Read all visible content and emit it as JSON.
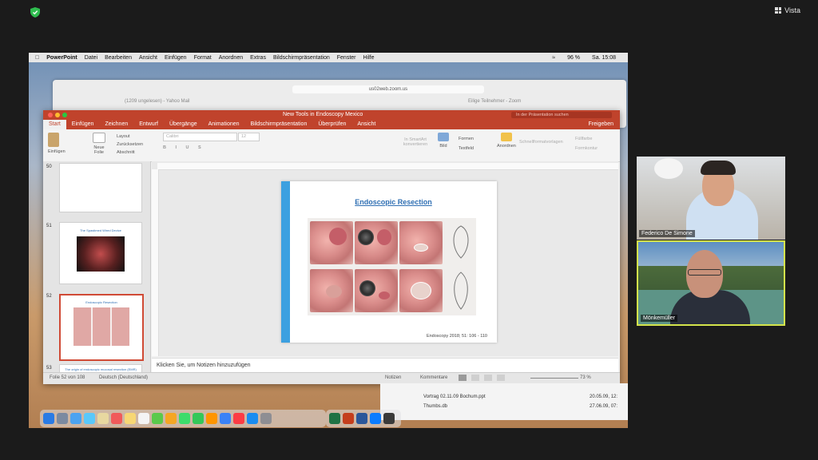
{
  "zoom": {
    "view_label": "Vista"
  },
  "menubar": {
    "app": "PowerPoint",
    "items": [
      "Datei",
      "Bearbeiten",
      "Ansicht",
      "Einfügen",
      "Format",
      "Anordnen",
      "Extras",
      "Bildschirmpräsentation",
      "Fenster",
      "Hilfe"
    ],
    "battery": "96 %",
    "clock": "Sa. 15:08"
  },
  "safari": {
    "url": "us02web.zoom.us",
    "tab1": "(1209 ungelesen) - Yahoo Mail",
    "tab2": "Eilige Teilnehmer - Zoom"
  },
  "ppt": {
    "title": "New Tools in Endoscopy Mexico",
    "search_placeholder": "In der Präsentation suchen",
    "tabs": [
      "Start",
      "Einfügen",
      "Zeichnen",
      "Entwurf",
      "Übergänge",
      "Animationen",
      "Bildschirmpräsentation",
      "Überprüfen",
      "Ansicht"
    ],
    "share": "Freigeben",
    "ribbon": {
      "paste": "Einfügen",
      "new_slide": "Neue Folie",
      "layout": "Layout",
      "reset": "Zurücksetzen",
      "section": "Abschnitt",
      "font": "Calibri",
      "size": "12",
      "smartart": "In SmartArt konvertieren",
      "image": "Bild",
      "shapes": "Formen",
      "textbox": "Textfeld",
      "arrange": "Anordnen",
      "quick_styles": "Schnellformatvorlagen",
      "fill": "Füllfarbe",
      "outline": "Formkontur"
    },
    "thumbs": [
      {
        "num": "50",
        "title": ""
      },
      {
        "num": "51",
        "title": "The Spastimed Wired Device"
      },
      {
        "num": "52",
        "title": "Endoscopic Resection"
      },
      {
        "num": "53",
        "title": "The origin of endoscopic mucosal resection (EMR)"
      }
    ],
    "slide": {
      "title": "Endoscopic Resection",
      "citation": "Endoscopy 2018; 51: 106 - 110"
    },
    "notes_placeholder": "Klicken Sie, um Notizen hinzuzufügen",
    "status": {
      "slide_count": "Folie 52 von 108",
      "language": "Deutsch (Deutschland)",
      "notes": "Notizen",
      "comments": "Kommentare",
      "zoom": "73 %"
    }
  },
  "finder": {
    "file1": "Vortrag 02.11.09 Bochum.ppt",
    "file1_date": "20.05.09, 12:",
    "file2": "Thumbs.db",
    "file2_date": "27.06.09, 07:"
  },
  "participants": [
    {
      "name": "Federico De Simone"
    },
    {
      "name": "Mönkemüller"
    }
  ]
}
